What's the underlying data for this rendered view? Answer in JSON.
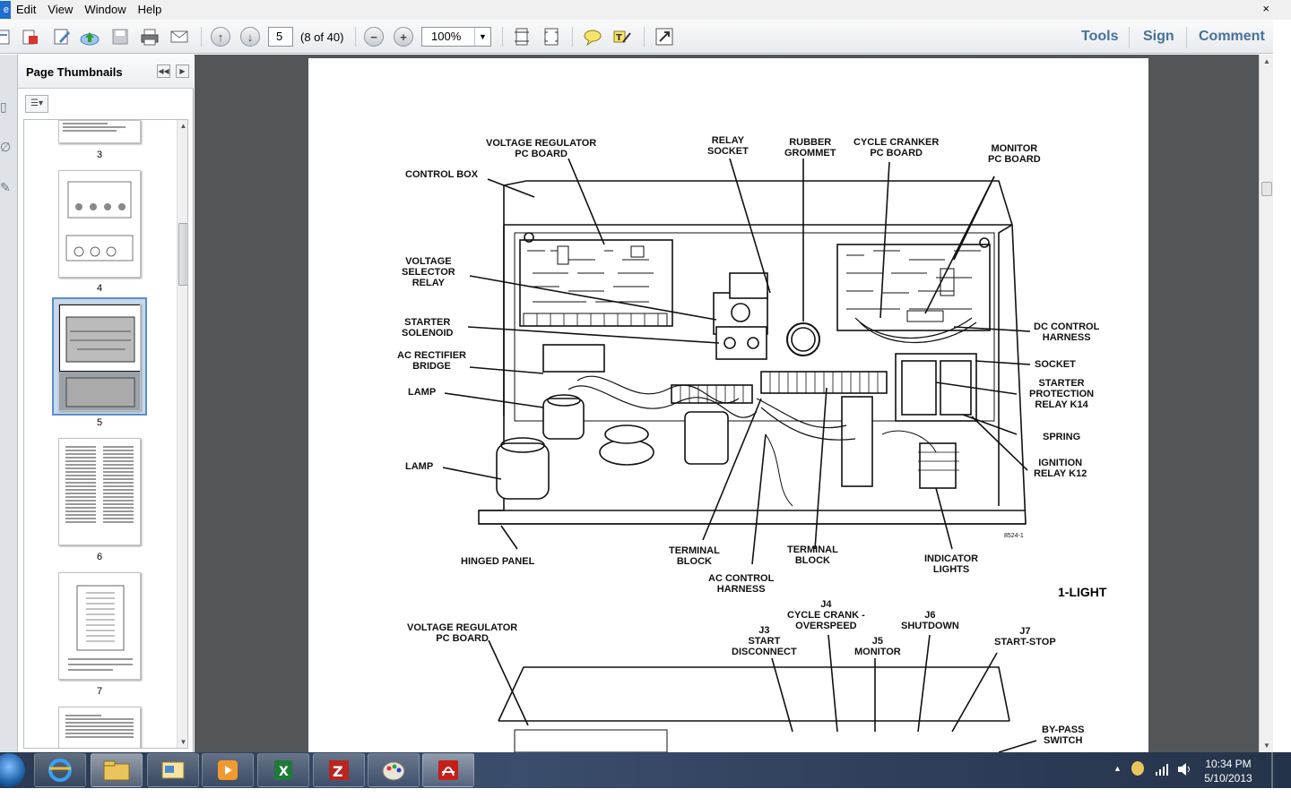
{
  "menubar": {
    "items": [
      "Edit",
      "View",
      "Window",
      "Help"
    ],
    "app_icon_letter": "e",
    "close_glyph": "×"
  },
  "toolbar": {
    "page_number": "5",
    "page_count": "(8 of 40)",
    "zoom": "100%",
    "right_buttons": [
      "Tools",
      "Sign",
      "Comment"
    ]
  },
  "sidebar": {
    "title": "Page Thumbnails",
    "thumbnails": [
      {
        "label": "3"
      },
      {
        "label": "4"
      },
      {
        "label": "5",
        "selected": true
      },
      {
        "label": "6"
      },
      {
        "label": "7"
      }
    ]
  },
  "document": {
    "figure_title": "1-LIGHT",
    "figure_code": "8524-1",
    "labels": {
      "voltage_regulator": "VOLTAGE REGULATOR\nPC BOARD",
      "relay_socket": "RELAY\nSOCKET",
      "rubber_grommet": "RUBBER\nGROMMET",
      "cycle_cranker": "CYCLE CRANKER\nPC BOARD",
      "monitor_pc": "MONITOR\nPC BOARD",
      "control_box": "CONTROL BOX",
      "voltage_selector": "VOLTAGE\nSELECTOR\nRELAY",
      "starter_solenoid": "STARTER\nSOLENOID",
      "ac_rectifier": "AC RECTIFIER\nBRIDGE",
      "lamp1": "LAMP",
      "lamp2": "LAMP",
      "dc_control": "DC CONTROL\nHARNESS",
      "socket": "SOCKET",
      "starter_protection": "STARTER\nPROTECTION\nRELAY K14",
      "spring": "SPRING",
      "ignition_relay": "IGNITION\nRELAY K12",
      "hinged_panel": "HINGED PANEL",
      "terminal_block1": "TERMINAL\nBLOCK",
      "terminal_block2": "TERMINAL\nBLOCK",
      "ac_control": "AC CONTROL\nHARNESS",
      "indicator_lights": "INDICATOR\nLIGHTS",
      "voltage_regulator2": "VOLTAGE REGULATOR\nPC BOARD",
      "j3": "J3\nSTART\nDISCONNECT",
      "j4": "J4\nCYCLE CRANK -\nOVERSPEED",
      "j5": "J5\nMONITOR",
      "j6": "J6\nSHUTDOWN",
      "j7": "J7\nSTART-STOP",
      "bypass": "BY-PASS\nSWITCH"
    }
  },
  "taskbar": {
    "time": "10:34 PM",
    "date": "5/10/2013",
    "apps": [
      "internet-explorer",
      "file-explorer",
      "outlook",
      "media-player",
      "excel",
      "filezilla",
      "paint",
      "adobe-reader"
    ]
  }
}
